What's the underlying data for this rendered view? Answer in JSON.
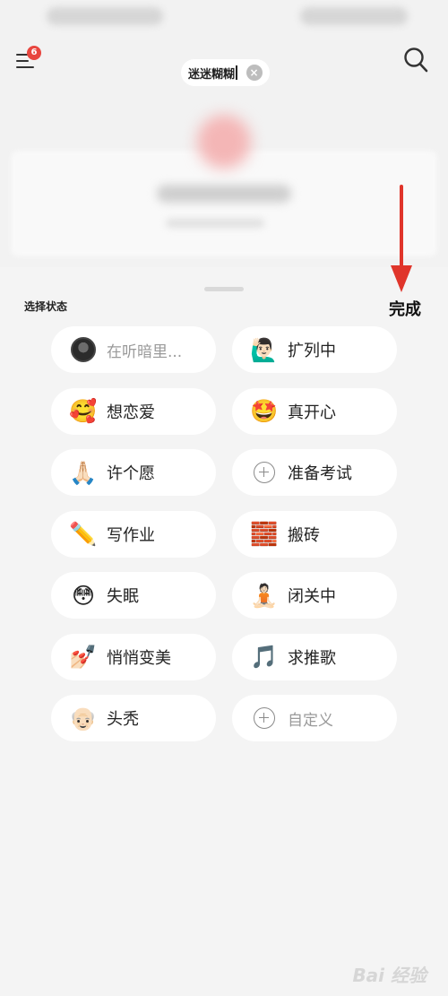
{
  "header": {
    "badge_count": "6",
    "name_input_value": "迷迷糊糊"
  },
  "sheet": {
    "title": "选择状态",
    "done_label": "完成"
  },
  "statuses": [
    {
      "label": "在听暗里...",
      "icon": "avatar-image"
    },
    {
      "label": "扩列中",
      "icon": "🙋🏻‍♂️"
    },
    {
      "label": "想恋爱",
      "icon": "🥰"
    },
    {
      "label": "真开心",
      "icon": "🤩"
    },
    {
      "label": "许个愿",
      "icon": "🙏🏻"
    },
    {
      "label": "准备考试",
      "icon": "plus-circle"
    },
    {
      "label": "写作业",
      "icon": "✏️"
    },
    {
      "label": "搬砖",
      "icon": "🧱"
    },
    {
      "label": "失眠",
      "icon": "😳"
    },
    {
      "label": "闭关中",
      "icon": "🧘🏻"
    },
    {
      "label": "悄悄变美",
      "icon": "💅🏻"
    },
    {
      "label": "求推歌",
      "icon": "🎵"
    },
    {
      "label": "头秃",
      "icon": "👴🏻"
    },
    {
      "label": "自定义",
      "icon": "plus-circle"
    }
  ],
  "watermark": "Bai 经验",
  "colors": {
    "badge": "#e8463f",
    "arrow": "#e0352b",
    "background": "#f2f2f2"
  }
}
